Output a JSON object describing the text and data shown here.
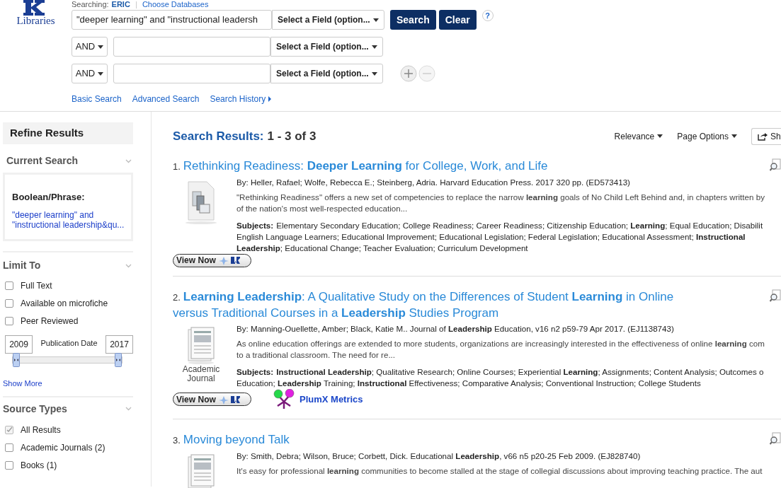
{
  "header": {
    "logo_text": "Libraries",
    "searching_label": "Searching:",
    "database": "ERIC",
    "choose_databases": "Choose Databases",
    "rows": [
      {
        "operator": null,
        "value": "\"deeper learning\" and \"instructional leadersh",
        "field": "Select a Field (option..."
      },
      {
        "operator": "AND",
        "value": null,
        "field": "Select a Field (option..."
      },
      {
        "operator": "AND",
        "value": null,
        "field": "Select a Field (option..."
      }
    ],
    "search_button": "Search",
    "clear_button": "Clear",
    "help": "?",
    "links": [
      "Basic Search",
      "Advanced Search",
      "Search History"
    ]
  },
  "sidebar": {
    "title": "Refine Results",
    "current_search": {
      "heading": "Current Search",
      "label": "Boolean/Phrase:",
      "query_lines": [
        "\"deeper learning\" and",
        "\"instructional leadership&qu..."
      ]
    },
    "limit_to": {
      "heading": "Limit To",
      "options": [
        {
          "label": "Full Text",
          "checked": false
        },
        {
          "label": "Available on microfiche",
          "checked": false
        },
        {
          "label": "Peer Reviewed",
          "checked": false
        }
      ],
      "date_from": "2009",
      "date_label": "Publication Date",
      "date_to": "2017",
      "date_handles": [
        {
          "level": 0
        },
        {
          "level": 1
        }
      ],
      "show_more": "Show More"
    },
    "source_types": {
      "heading": "Source Types",
      "options": [
        {
          "label": "All Results",
          "checked": true
        },
        {
          "label": "Academic Journals (2)",
          "checked": false
        },
        {
          "label": "Books (1)",
          "checked": false
        }
      ]
    }
  },
  "results": {
    "heading": "Search Results:",
    "range": "1 - 3 of 3",
    "sort": "Relevance",
    "page_options": "Page Options",
    "share": "Sh",
    "items": [
      {
        "number": "1.",
        "kind": "book",
        "title": "Rethinking Readiness: **Deeper Learning** for College, Work, and Life",
        "byline": "By: Heller, Rafael; Wolfe, Rebecca E.; Steinberg, Adria. Harvard Education Press. 2017 320 pp. (ED573413)",
        "abstract": [
          "\"Rethinking Readiness\" offers a new set of competencies to replace the narrow **learning** goals of No Child Left Behind and, in chapters written by",
          "of the nation's most well-respected education..."
        ],
        "subjects_label": "Subjects:",
        "subjects": [
          "Elementary Secondary Education; College Readiness; Career Readiness; Citizenship Education; **Learning**; Equal Education; Disabilit",
          "English Language Learners; Educational Improvement; Educational Legislation; Federal Legislation; Educational Assessment; **Instructional**",
          "**Leadership**; Educational Change; Teacher Evaluation; Curriculum Development"
        ],
        "view_now": "View Now"
      },
      {
        "number": "2.",
        "kind": "journal",
        "title": "**Learning Leadership**: A Qualitative Study on the Differences of Student **Learning** in Online versus Traditional Courses in a **Leadership** Studies Program",
        "type_label": "Academic Journal",
        "byline": "By: Manning-Ouellette, Amber; Black, Katie M.. Journal of **Leadership** Education, v16 n2 p59-79 Apr 2017. (EJ1138743)",
        "abstract": [
          "As online education offerings are extended to more students, organizations are increasingly interested in the effectiveness of online **learning** com",
          "to a traditional classroom. The need for re..."
        ],
        "subjects_label": "Subjects:",
        "subjects": [
          "**Instructional Leadership**; Qualitative Research; Online Courses; Experiential **Learning**; Assignments; Content Analysis; Outcomes o",
          "Education; **Leadership** Training; **Instructional** Effectiveness; Comparative Analysis; Conventional Instruction; College Students"
        ],
        "view_now": "View Now",
        "plumx": "PlumX Metrics"
      },
      {
        "number": "3.",
        "kind": "journal",
        "title": "Moving beyond Talk",
        "byline": "By: Smith, Debra; Wilson, Bruce; Corbett, Dick. Educational **Leadership**, v66 n5 p20-25 Feb 2009. (EJ828740)",
        "abstract": [
          "It's easy for professional **learning** communities to become stalled at the stage of collegial discussions about improving teaching practice. The aut"
        ]
      }
    ]
  }
}
